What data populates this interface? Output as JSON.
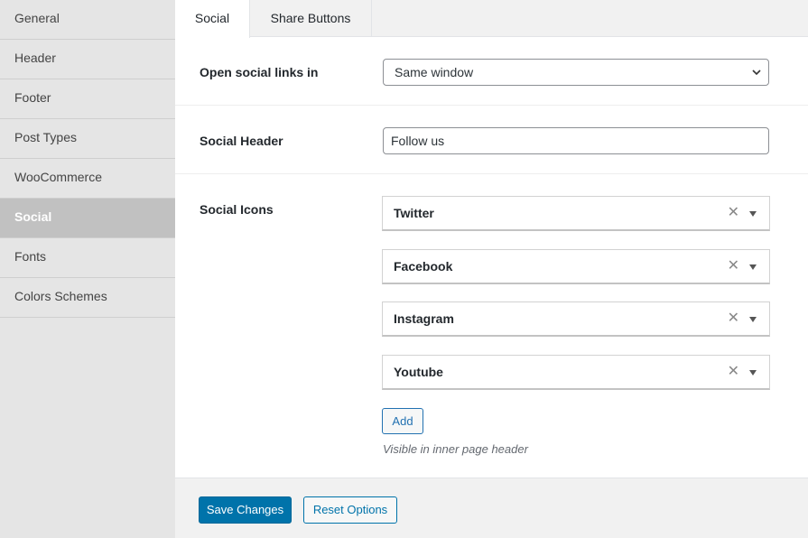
{
  "sidebar": {
    "items": [
      {
        "label": "General"
      },
      {
        "label": "Header"
      },
      {
        "label": "Footer"
      },
      {
        "label": "Post Types"
      },
      {
        "label": "WooCommerce"
      },
      {
        "label": "Social",
        "active": true
      },
      {
        "label": "Fonts"
      },
      {
        "label": "Colors Schemes"
      }
    ]
  },
  "tabs": [
    {
      "label": "Social",
      "active": true
    },
    {
      "label": "Share Buttons"
    }
  ],
  "open_links": {
    "label": "Open social links in",
    "selected": "Same window"
  },
  "social_header": {
    "label": "Social Header",
    "value": "Follow us"
  },
  "social_icons": {
    "label": "Social Icons",
    "items": [
      {
        "label": "Twitter"
      },
      {
        "label": "Facebook"
      },
      {
        "label": "Instagram"
      },
      {
        "label": "Youtube"
      }
    ],
    "clear_glyph": "✕",
    "add_label": "Add",
    "help": "Visible in inner page header"
  },
  "footer": {
    "save_label": "Save Changes",
    "reset_label": "Reset Options"
  },
  "colors": {
    "primary": "#0073aa",
    "sidebar_bg": "#e5e5e5",
    "sidebar_active_bg": "#c1c1c1"
  }
}
